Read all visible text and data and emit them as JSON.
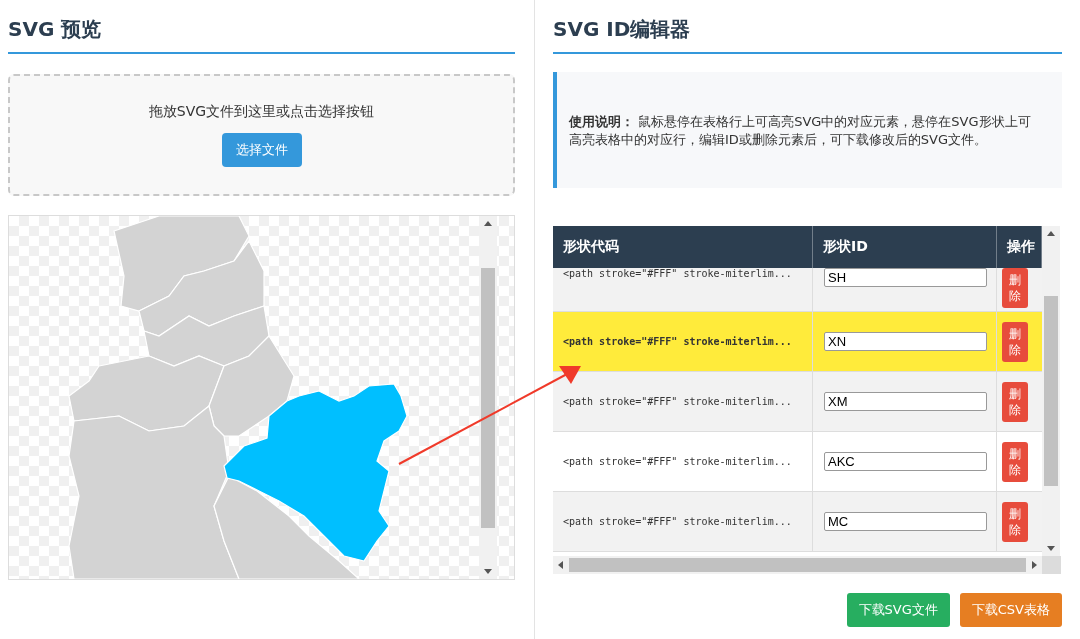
{
  "preview": {
    "title": "SVG 预览",
    "drop_hint": "拖放SVG文件到这里或点击选择按钮",
    "choose_button": "选择文件"
  },
  "editor": {
    "title": "SVG ID编辑器",
    "help_label": "使用说明：",
    "help_text": "鼠标悬停在表格行上可高亮SVG中的对应元素，悬停在SVG形状上可高亮表格中的对应行，编辑ID或删除元素后，可下载修改后的SVG文件。"
  },
  "table": {
    "columns": [
      "形状代码",
      "形状ID",
      "操作"
    ],
    "rows": [
      {
        "code": "<path stroke=\"#FFF\" stroke-miterlim...",
        "id": "SH",
        "delete": "删除",
        "highlighted": false
      },
      {
        "code": "<path stroke=\"#FFF\" stroke-miterlim...",
        "id": "XN",
        "delete": "删除",
        "highlighted": true
      },
      {
        "code": "<path stroke=\"#FFF\" stroke-miterlim...",
        "id": "XM",
        "delete": "删除",
        "highlighted": false
      },
      {
        "code": "<path stroke=\"#FFF\" stroke-miterlim...",
        "id": "AKC",
        "delete": "删除",
        "highlighted": false
      },
      {
        "code": "<path stroke=\"#FFF\" stroke-miterlim...",
        "id": "MC",
        "delete": "删除",
        "highlighted": false
      }
    ]
  },
  "actions": [
    {
      "label": "下载SVG文件",
      "kind": "svg"
    },
    {
      "label": "下载CSV表格",
      "kind": "csv"
    }
  ]
}
